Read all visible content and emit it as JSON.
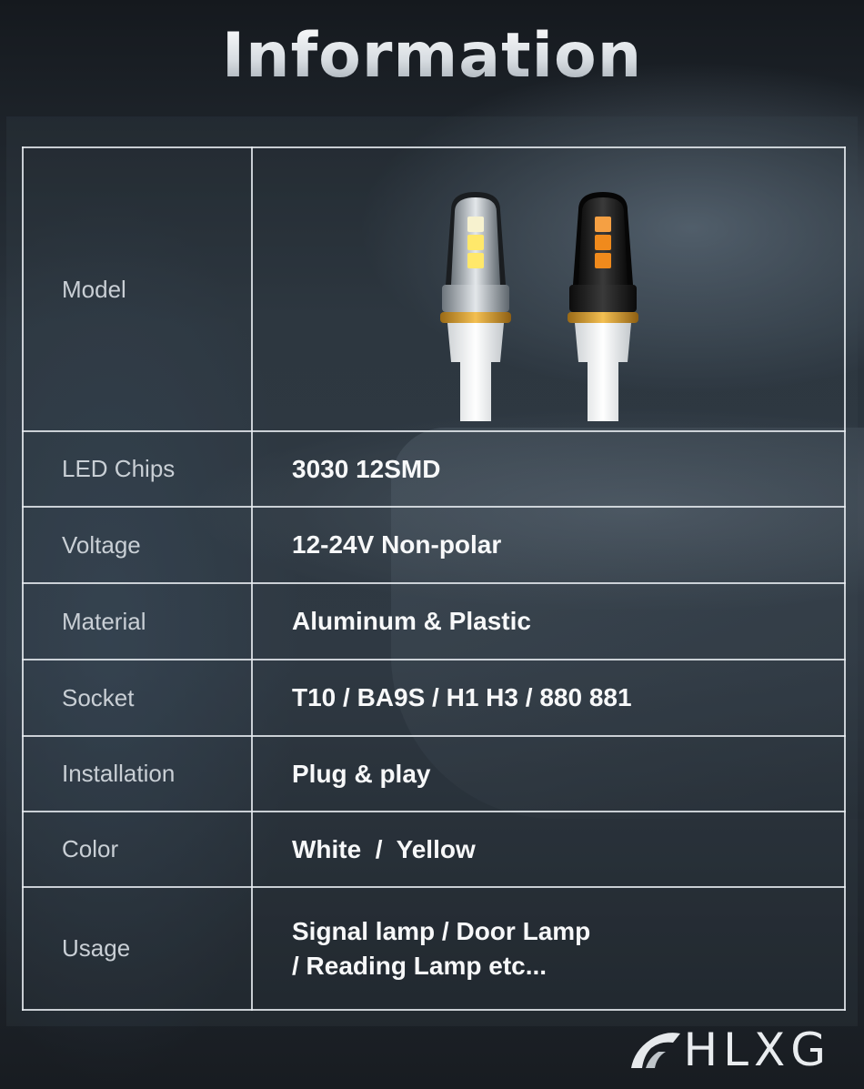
{
  "title": "Information",
  "specs": {
    "model": {
      "label": "Model"
    },
    "led_chips": {
      "label": "LED Chips",
      "value": "3030 12SMD"
    },
    "voltage": {
      "label": "Voltage",
      "value": "12-24V Non-polar"
    },
    "material": {
      "label": "Material",
      "value": "Aluminum & Plastic"
    },
    "socket": {
      "label": "Socket",
      "value": "T10 / BA9S / H1 H3 / 880 881"
    },
    "installation": {
      "label": "Installation",
      "value": "Plug & play"
    },
    "color": {
      "label": "Color",
      "value": "White  /  Yellow"
    },
    "usage": {
      "label": "Usage",
      "value_line1": "Signal lamp / Door Lamp",
      "value_line2": "/ Reading Lamp etc..."
    }
  },
  "product_images": [
    {
      "name": "white-led-bulb",
      "chip_color": "#ffe86a",
      "body_color": "#c9ced3"
    },
    {
      "name": "yellow-led-bulb",
      "chip_color": "#f08a1c",
      "body_color": "#1a1a1a"
    }
  ],
  "brand": {
    "logo_text": "HLXG"
  },
  "colors": {
    "accent_ring": "#e0a030",
    "border": "#e6ebf0"
  }
}
